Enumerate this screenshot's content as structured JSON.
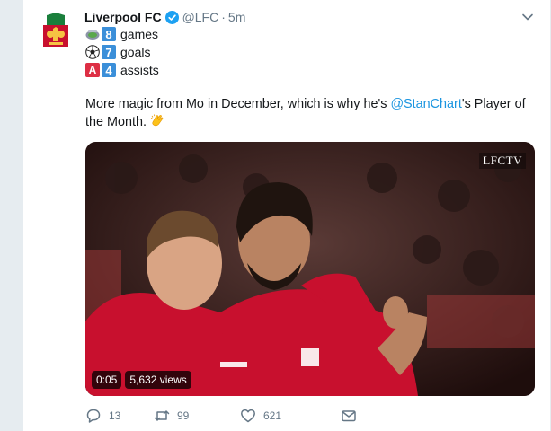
{
  "tweet": {
    "author_name": "Liverpool FC",
    "handle": "@LFC",
    "separator": "·",
    "time": "5m",
    "stats": [
      {
        "emoji": "stadium-icon",
        "number": "8",
        "label": "games"
      },
      {
        "emoji": "soccer-ball-icon",
        "number": "7",
        "label": "goals"
      },
      {
        "emoji": "a-button-icon",
        "number": "4",
        "label": "assists"
      }
    ],
    "text_before": "More magic from Mo in December, which is why he's ",
    "mention": "@StanChart",
    "text_after": "'s Player of the Month. ",
    "clap_emoji": "clapping-hands-icon",
    "a_letter": "A"
  },
  "media": {
    "watermark": "LFCTV",
    "duration": "0:05",
    "views": "5,632 views"
  },
  "actions": {
    "replies": "13",
    "retweets": "99",
    "likes": "621"
  },
  "colors": {
    "accent": "#1b95e0",
    "muted": "#657786",
    "verified": "#1da1f2",
    "lfc_red": "#c8102e"
  }
}
